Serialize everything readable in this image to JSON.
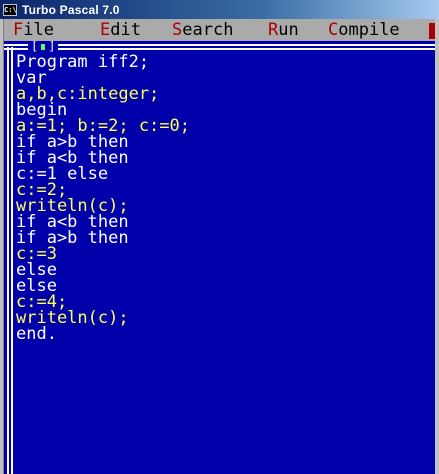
{
  "window": {
    "title": "Turbo Pascal 7.0",
    "icon_label": "C:\\"
  },
  "menu": {
    "items": [
      {
        "hot": "F",
        "rest": "ile"
      },
      {
        "hot": "E",
        "rest": "dit"
      },
      {
        "hot": "S",
        "rest": "earch"
      },
      {
        "hot": "R",
        "rest": "un"
      },
      {
        "hot": "C",
        "rest": "ompile"
      }
    ]
  },
  "editor": {
    "close_box_left": "[",
    "close_box_right": "]",
    "lines": [
      {
        "text": "Program iff2;",
        "color": "#ffffff"
      },
      {
        "text": "var",
        "color": "#ffffff"
      },
      {
        "text": "a,b,c:integer;",
        "color": "#ffff55"
      },
      {
        "text": "begin",
        "color": "#ffffff"
      },
      {
        "text": "a:=1; b:=2; c:=0;",
        "color": "#ffff55"
      },
      {
        "text": "if a>b then",
        "color": "#ffffff"
      },
      {
        "text": "if a<b then",
        "color": "#ffffff"
      },
      {
        "text": "c:=1 else",
        "color": "#ffffff"
      },
      {
        "text": "c:=2;",
        "color": "#ffff55"
      },
      {
        "text": "writeln(c);",
        "color": "#ffff55"
      },
      {
        "text": "if a<b then",
        "color": "#ffffff"
      },
      {
        "text": "if a>b then",
        "color": "#ffffff"
      },
      {
        "text": "c:=3",
        "color": "#ffff55"
      },
      {
        "text": "else",
        "color": "#ffffff"
      },
      {
        "text": "else",
        "color": "#ffffff"
      },
      {
        "text": "c:=4;",
        "color": "#ffff55"
      },
      {
        "text": "writeln(c);",
        "color": "#ffff55"
      },
      {
        "text": "end.",
        "color": "#ffffff"
      }
    ]
  },
  "colors": {
    "editor_background": "#0000aa",
    "menu_background": "#aaaaaa",
    "menu_hotkey": "#aa0000",
    "code_white": "#ffffff",
    "code_yellow": "#ffff55"
  }
}
